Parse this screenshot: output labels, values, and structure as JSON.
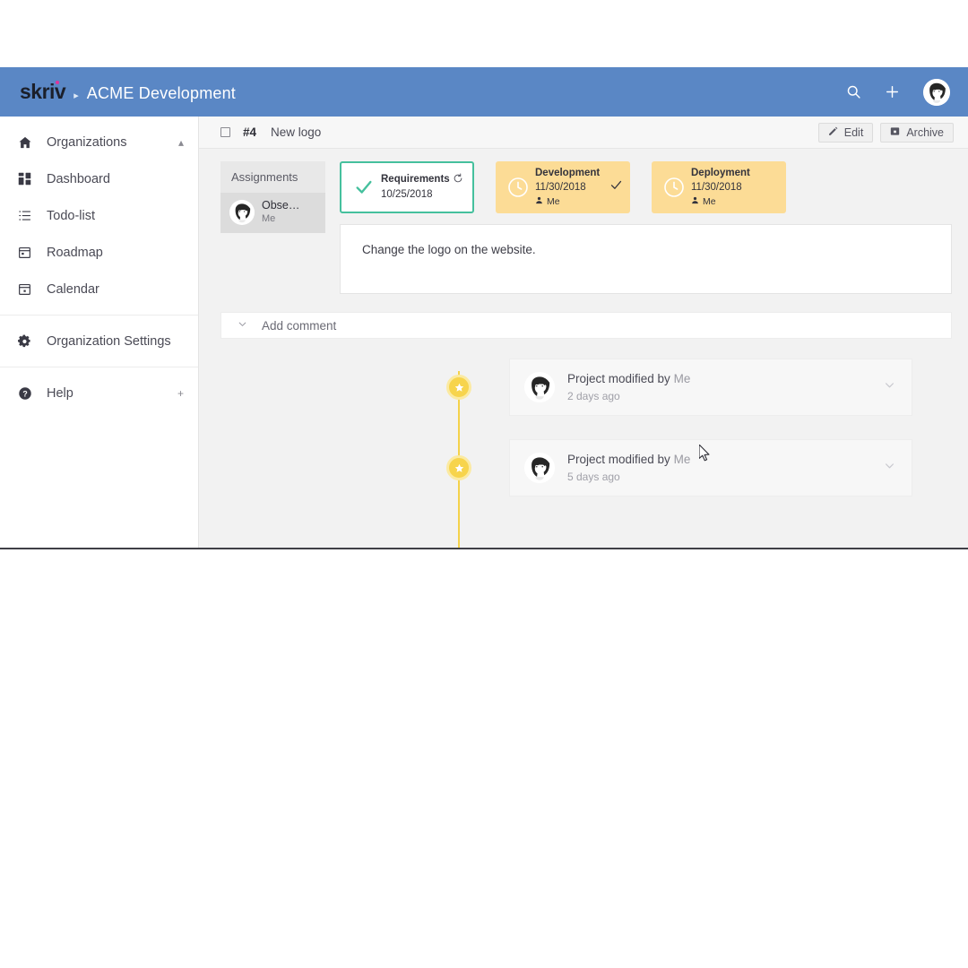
{
  "topbar": {
    "logo_text": "skriv",
    "separator": "▸",
    "org_name": "ACME Development",
    "search_icon": "search-icon",
    "add_icon": "plus-icon",
    "avatar_icon": "user-avatar"
  },
  "sidebar": {
    "groups": [
      {
        "items": [
          {
            "label": "Organizations",
            "icon": "home-icon",
            "affix": "▴"
          },
          {
            "label": "Dashboard",
            "icon": "grid-icon",
            "affix": ""
          },
          {
            "label": "Todo-list",
            "icon": "list-icon",
            "affix": ""
          },
          {
            "label": "Roadmap",
            "icon": "calendar-icon",
            "affix": ""
          },
          {
            "label": "Calendar",
            "icon": "calendar-day-icon",
            "affix": ""
          }
        ]
      },
      {
        "items": [
          {
            "label": "Organization Settings",
            "icon": "gear-icon",
            "affix": ""
          }
        ]
      },
      {
        "items": [
          {
            "label": "Help",
            "icon": "help-circle-icon",
            "affix": "+"
          }
        ]
      }
    ]
  },
  "task": {
    "number": "#4",
    "title": "New logo",
    "checkbox_checked": false,
    "edit_label": "Edit",
    "archive_label": "Archive",
    "description": "Change the logo on the website."
  },
  "assignments": {
    "title": "Assignments",
    "assignee_name": "Obse…",
    "assignee_role": "Me"
  },
  "stages": [
    {
      "name": "Requirements",
      "date": "10/25/2018",
      "user": "",
      "state": "done",
      "lead_icon": "check-icon",
      "trail_icon": "refresh-icon"
    },
    {
      "name": "Development",
      "date": "11/30/2018",
      "user": "Me",
      "state": "pending",
      "lead_icon": "clock-icon",
      "trail_icon": "check-icon"
    },
    {
      "name": "Deployment",
      "date": "11/30/2018",
      "user": "Me",
      "state": "pending",
      "lead_icon": "clock-icon",
      "trail_icon": ""
    }
  ],
  "comment": {
    "label": "Add comment",
    "chevron_icon": "chevron-down-icon"
  },
  "activity": [
    {
      "text": "Project modified by",
      "who": "Me",
      "time": "2 days ago",
      "marker_icon": "star-icon",
      "expand_icon": "chevron-down-icon"
    },
    {
      "text": "Project modified by",
      "who": "Me",
      "time": "5 days ago",
      "marker_icon": "star-icon",
      "expand_icon": "chevron-down-icon"
    }
  ],
  "colors": {
    "header_blue": "#5a87c5",
    "accent_pink": "#e0359a",
    "stage_done_green": "#45c09d",
    "stage_pending_yellow": "#fcdc96",
    "timeline_yellow": "#f7d44c",
    "page_bg": "#f2f2f2"
  }
}
